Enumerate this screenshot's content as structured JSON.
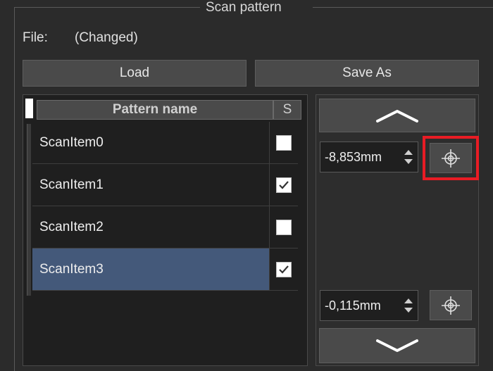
{
  "group": {
    "title": "Scan pattern"
  },
  "file": {
    "label": "File:",
    "value": "(Changed)"
  },
  "buttons": {
    "load": "Load",
    "save_as": "Save As"
  },
  "table": {
    "columns": [
      "Pattern name",
      "S"
    ],
    "rows": [
      {
        "name": "ScanItem0",
        "checked": false,
        "selected": false
      },
      {
        "name": "ScanItem1",
        "checked": true,
        "selected": false
      },
      {
        "name": "ScanItem2",
        "checked": false,
        "selected": false
      },
      {
        "name": "ScanItem3",
        "checked": true,
        "selected": true
      }
    ]
  },
  "right": {
    "upper_value": "-8,853mm",
    "lower_value": "-0,115mm",
    "upper_target_highlighted": true
  },
  "colors": {
    "selection": "#44597a",
    "highlight": "#e81c24",
    "background": "#2b2b2b"
  }
}
